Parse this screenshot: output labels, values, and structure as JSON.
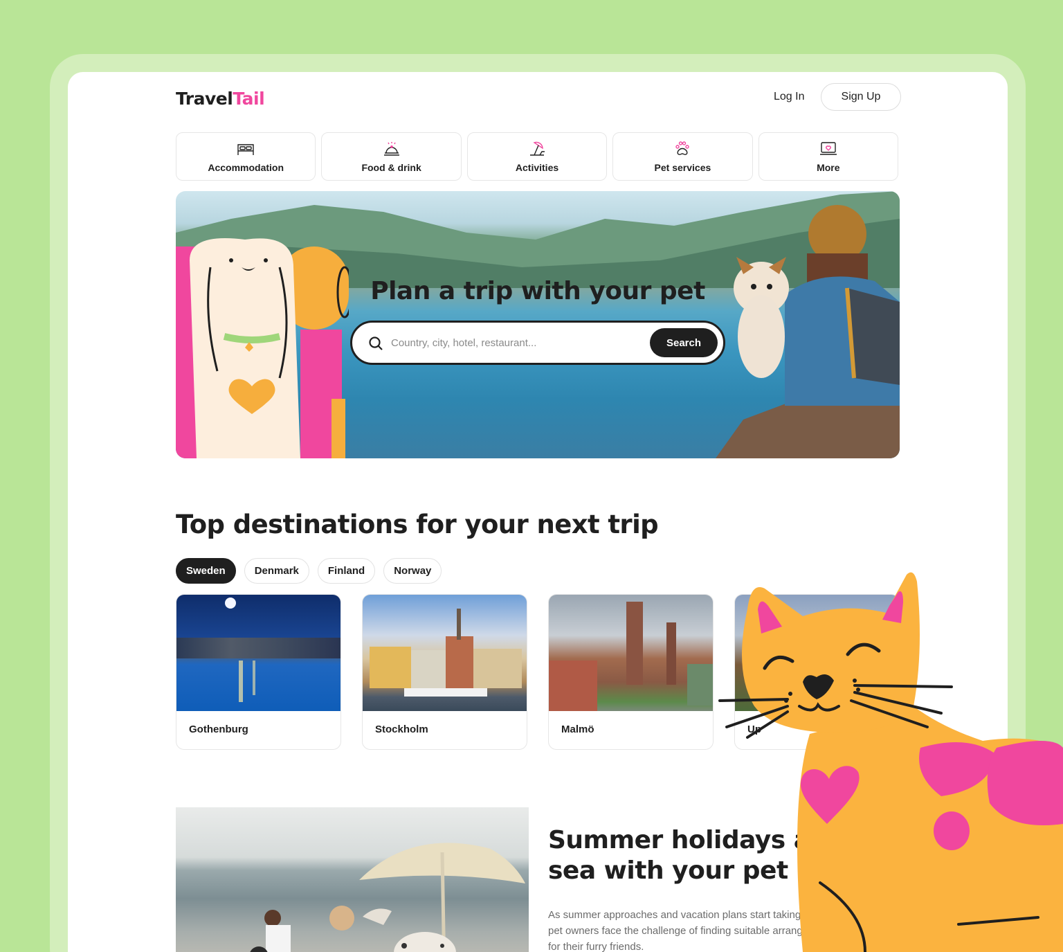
{
  "header": {
    "logo_part1": "Travel",
    "logo_part2": "Tail",
    "login_label": "Log In",
    "signup_label": "Sign Up"
  },
  "categories": [
    {
      "label": "Accommodation",
      "icon": "bed-icon"
    },
    {
      "label": "Food & drink",
      "icon": "cloche-icon"
    },
    {
      "label": "Activities",
      "icon": "beach-umbrella-icon"
    },
    {
      "label": "Pet services",
      "icon": "paw-icon"
    },
    {
      "label": "More",
      "icon": "laptop-heart-icon"
    }
  ],
  "hero": {
    "title": "Plan a trip with your pet",
    "search_placeholder": "Country, city, hotel, restaurant...",
    "search_button": "Search"
  },
  "destinations": {
    "title": "Top destinations for your next trip",
    "tabs": [
      {
        "label": "Sweden",
        "active": true
      },
      {
        "label": "Denmark",
        "active": false
      },
      {
        "label": "Finland",
        "active": false
      },
      {
        "label": "Norway",
        "active": false
      }
    ],
    "cards": [
      {
        "name": "Gothenburg"
      },
      {
        "name": "Stockholm"
      },
      {
        "name": "Malmö"
      },
      {
        "name": "Up"
      }
    ]
  },
  "summer": {
    "title_line1": "Summer holidays a",
    "title_line2": "sea with your pet",
    "text": "As summer approaches and vacation plans start taking many pet owners face the challenge of finding suitable arrangements for their furry friends."
  },
  "colors": {
    "background": "#b9e597",
    "accent_pink": "#f0479e",
    "dark": "#1f1f1f",
    "cat_orange": "#fbb33f"
  }
}
